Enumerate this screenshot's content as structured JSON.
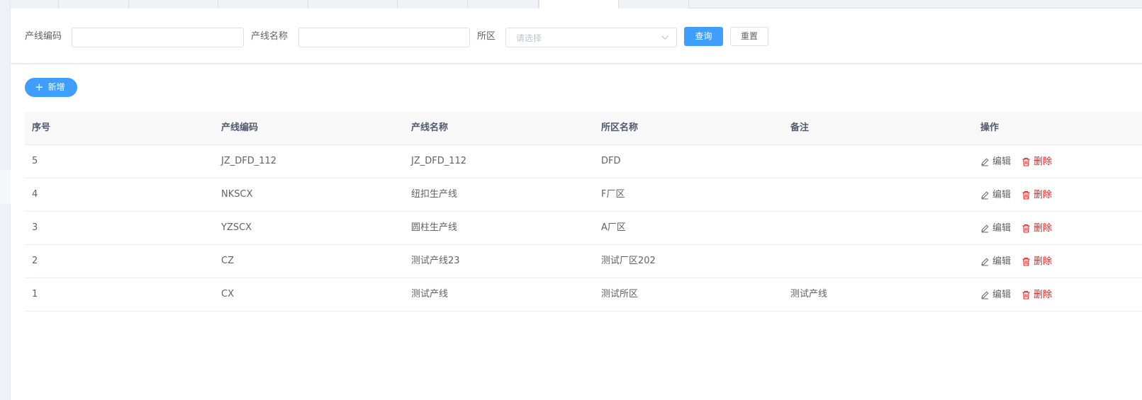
{
  "search": {
    "code_label": "产线编码",
    "code_value": "",
    "name_label": "产线名称",
    "name_value": "",
    "district_label": "所区",
    "district_placeholder": "请选择",
    "query_label": "查询",
    "reset_label": "重置"
  },
  "toolbar": {
    "add_label": "新增"
  },
  "table": {
    "columns": [
      "序号",
      "产线编码",
      "产线名称",
      "所区名称",
      "备注",
      "操作"
    ],
    "rows": [
      {
        "index": "5",
        "code": "JZ_DFD_112",
        "name": "JZ_DFD_112",
        "district": "DFD",
        "remark": ""
      },
      {
        "index": "4",
        "code": "NKSCX",
        "name": "纽扣生产线",
        "district": "F厂区",
        "remark": ""
      },
      {
        "index": "3",
        "code": "YZSCX",
        "name": "圆柱生产线",
        "district": "A厂区",
        "remark": ""
      },
      {
        "index": "2",
        "code": "CZ",
        "name": "测试产线23",
        "district": "测试厂区202",
        "remark": ""
      },
      {
        "index": "1",
        "code": "CX",
        "name": "测试产线",
        "district": "测试所区",
        "remark": "测试产线"
      }
    ],
    "edit_label": "编辑",
    "delete_label": "删除"
  },
  "colors": {
    "primary": "#409eff",
    "danger": "#f01c1c",
    "header_bg": "#f8f8f9"
  },
  "icons": {
    "edit": "pencil-icon",
    "delete": "trash-icon",
    "add": "plus-icon",
    "select": "chevron-down-icon"
  }
}
